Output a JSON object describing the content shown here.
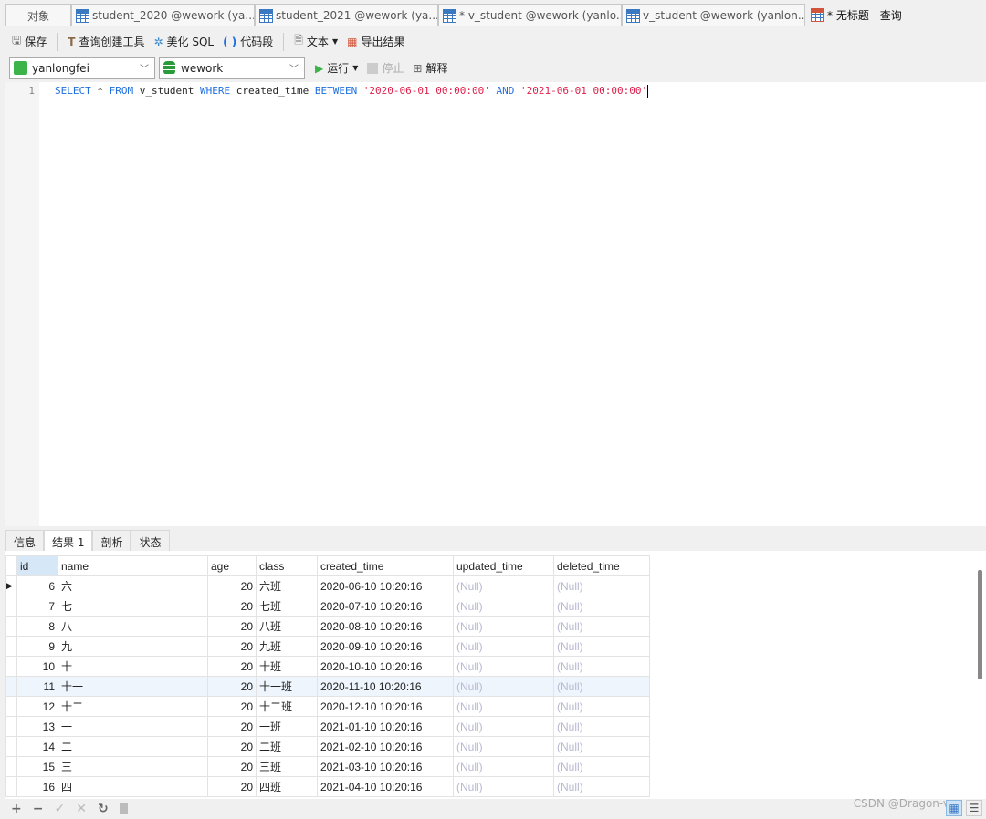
{
  "tabs": [
    {
      "label": "对象",
      "icon": "none"
    },
    {
      "label": "student_2020 @wework (ya...",
      "icon": "table-icon"
    },
    {
      "label": "student_2021 @wework (ya...",
      "icon": "table-icon"
    },
    {
      "label": "* v_student @wework (yanlo...",
      "icon": "view-design-icon"
    },
    {
      "label": "v_student @wework (yanlon...",
      "icon": "view-icon"
    },
    {
      "label": "* 无标题 - 查询",
      "icon": "query-icon"
    }
  ],
  "toolbar": {
    "save": "保存",
    "query_builder": "查询创建工具",
    "beautify": "美化 SQL",
    "snippet": "代码段",
    "text": "文本",
    "export": "导出结果"
  },
  "toolbar2": {
    "connection": "yanlongfei",
    "database": "wework",
    "run": "运行",
    "stop": "停止",
    "explain": "解释"
  },
  "editor": {
    "line": "1",
    "sql": {
      "k1": "SELECT",
      "p1": " * ",
      "k2": "FROM",
      "p2": " v_student ",
      "k3": "WHERE",
      "p3": " created_time ",
      "k4": "BETWEEN",
      "s1": "'2020-06-01 00:00:00'",
      "k5": "AND",
      "s2": "'2021-06-01 00:00:00'"
    }
  },
  "result_tabs": [
    "信息",
    "结果 1",
    "剖析",
    "状态"
  ],
  "columns": [
    "id",
    "name",
    "age",
    "class",
    "created_time",
    "updated_time",
    "deleted_time"
  ],
  "rows": [
    [
      "6",
      "六",
      "20",
      "六班",
      "2020-06-10 10:20:16",
      "(Null)",
      "(Null)"
    ],
    [
      "7",
      "七",
      "20",
      "七班",
      "2020-07-10 10:20:16",
      "(Null)",
      "(Null)"
    ],
    [
      "8",
      "八",
      "20",
      "八班",
      "2020-08-10 10:20:16",
      "(Null)",
      "(Null)"
    ],
    [
      "9",
      "九",
      "20",
      "九班",
      "2020-09-10 10:20:16",
      "(Null)",
      "(Null)"
    ],
    [
      "10",
      "十",
      "20",
      "十班",
      "2020-10-10 10:20:16",
      "(Null)",
      "(Null)"
    ],
    [
      "11",
      "十一",
      "20",
      "十一班",
      "2020-11-10 10:20:16",
      "(Null)",
      "(Null)"
    ],
    [
      "12",
      "十二",
      "20",
      "十二班",
      "2020-12-10 10:20:16",
      "(Null)",
      "(Null)"
    ],
    [
      "13",
      "一",
      "20",
      "一班",
      "2021-01-10 10:20:16",
      "(Null)",
      "(Null)"
    ],
    [
      "14",
      "二",
      "20",
      "二班",
      "2021-02-10 10:20:16",
      "(Null)",
      "(Null)"
    ],
    [
      "15",
      "三",
      "20",
      "三班",
      "2021-03-10 10:20:16",
      "(Null)",
      "(Null)"
    ],
    [
      "16",
      "四",
      "20",
      "四班",
      "2021-04-10 10:20:16",
      "(Null)",
      "(Null)"
    ]
  ],
  "watermark": "CSDN @Dragon-v",
  "colors": {
    "keyword": "#1f6fe0",
    "string": "#e0204a",
    "null": "#b8b8d0",
    "selected_row": "#eef5fc"
  }
}
